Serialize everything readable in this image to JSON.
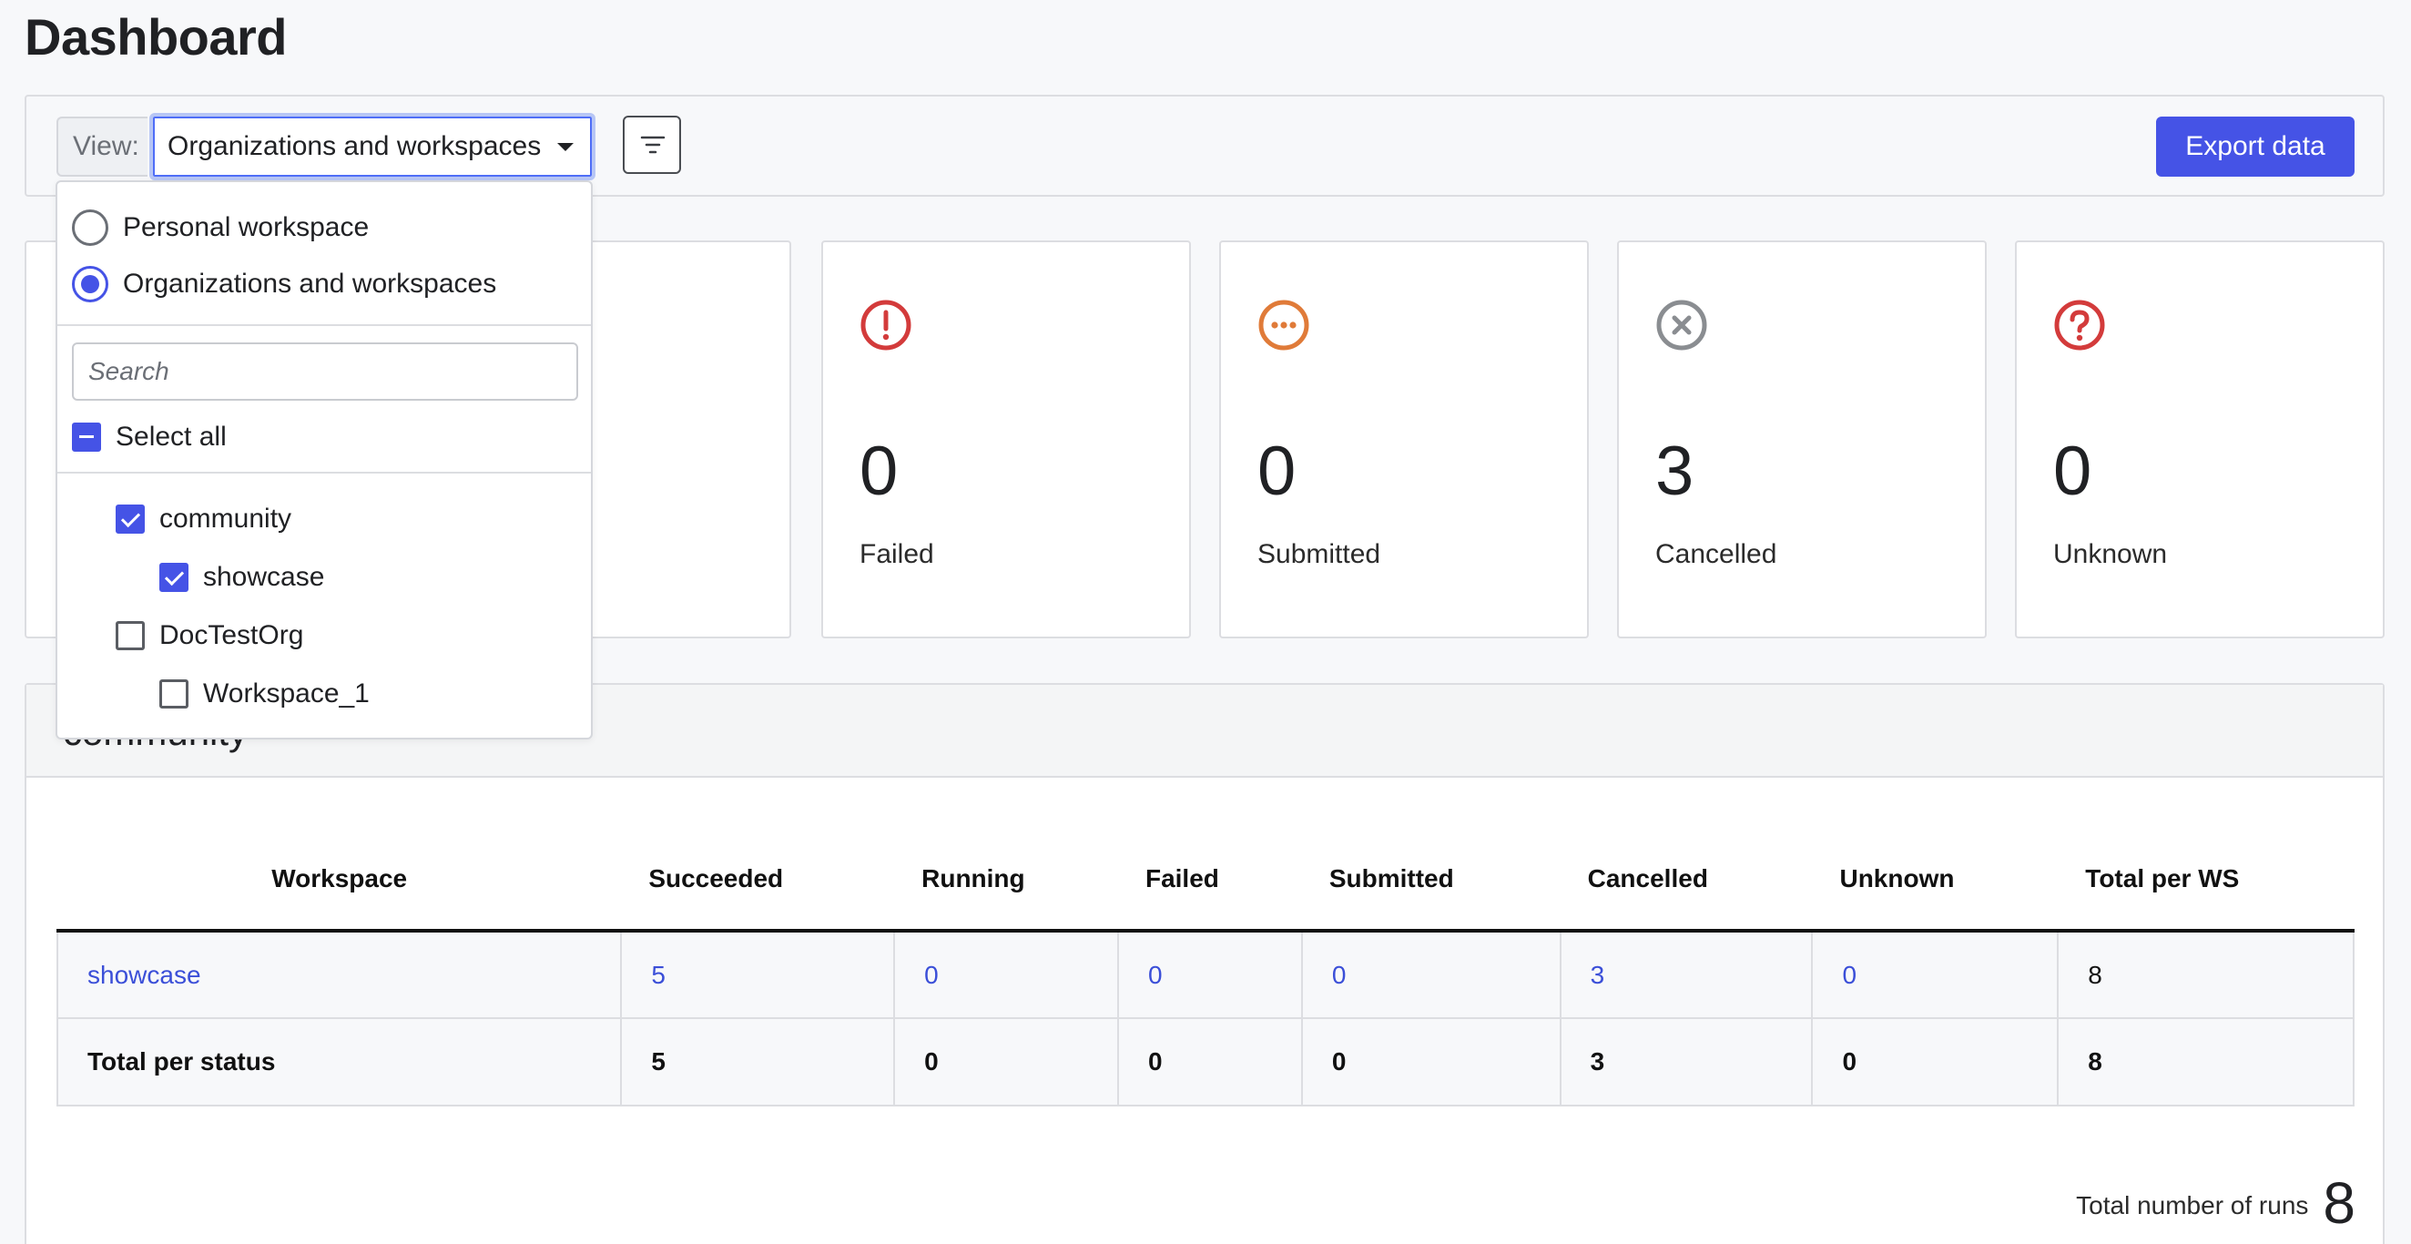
{
  "page": {
    "title": "Dashboard"
  },
  "toolbar": {
    "view_label": "View:",
    "view_value": "Organizations and workspaces",
    "export_label": "Export data"
  },
  "dropdown": {
    "radio_options": [
      {
        "label": "Personal workspace",
        "selected": false
      },
      {
        "label": "Organizations and workspaces",
        "selected": true
      }
    ],
    "search_placeholder": "Search",
    "select_all_label": "Select all",
    "tree": [
      {
        "label": "community",
        "checked": true
      },
      {
        "label": "showcase",
        "checked": true
      },
      {
        "label": "DocTestOrg",
        "checked": false
      },
      {
        "label": "Workspace_1",
        "checked": false
      }
    ]
  },
  "cards": [
    {
      "count": "0",
      "label": "Failed",
      "icon": "exclamation-circle-icon",
      "color": "#d33b3b"
    },
    {
      "count": "0",
      "label": "Submitted",
      "icon": "ellipsis-circle-icon",
      "color": "#e07b39"
    },
    {
      "count": "3",
      "label": "Cancelled",
      "icon": "x-circle-icon",
      "color": "#8a8d91"
    },
    {
      "count": "0",
      "label": "Unknown",
      "icon": "question-circle-icon",
      "color": "#d33b3b"
    }
  ],
  "panel": {
    "title": "community",
    "columns": [
      "Workspace",
      "Succeeded",
      "Running",
      "Failed",
      "Submitted",
      "Cancelled",
      "Unknown",
      "Total per WS"
    ],
    "rows": [
      {
        "cells": [
          "showcase",
          "5",
          "0",
          "0",
          "0",
          "3",
          "0",
          "8"
        ]
      }
    ],
    "total_row": [
      "Total per status",
      "5",
      "0",
      "0",
      "0",
      "3",
      "0",
      "8"
    ],
    "total_runs_label": "Total number of runs",
    "total_runs_value": "8"
  },
  "colors": {
    "accent": "#4553e6",
    "link": "#3b4fd8"
  }
}
